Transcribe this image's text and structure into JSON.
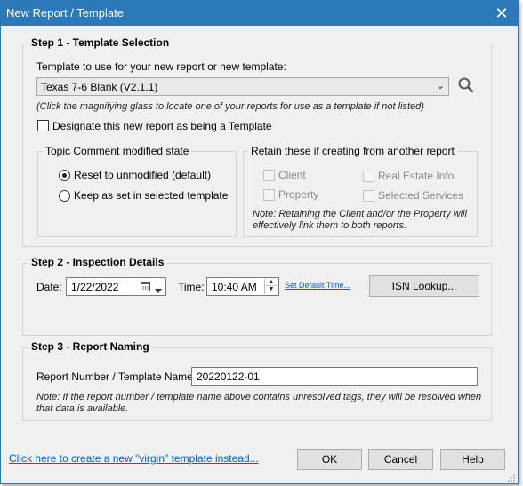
{
  "window": {
    "title": "New Report / Template",
    "close_glyph": "✕"
  },
  "step1": {
    "title": "Step 1 - Template Selection",
    "template_label": "Template to use for your new report or new template:",
    "template_value": "Texas 7-6 Blank (V2.1.1)",
    "magnify_note": "(Click the magnifying glass to locate one of your reports for use as a template if not listed)",
    "designate_label": "Designate this new report as being a Template",
    "designate_checked": false,
    "topic_group": {
      "title": "Topic Comment modified state",
      "options": [
        {
          "label": "Reset to unmodified (default)",
          "selected": true
        },
        {
          "label": "Keep as set in selected template",
          "selected": false
        }
      ]
    },
    "retain_group": {
      "title": "Retain these if creating from another report",
      "client": "Client",
      "property": "Property",
      "real_estate": "Real Estate Info",
      "selected_services": "Selected Services",
      "note_line1": "Note: Retaining the Client and/or the Property will",
      "note_line2": "effectively link them to both reports."
    }
  },
  "step2": {
    "title": "Step 2 - Inspection Details",
    "date_label": "Date:",
    "date_value": "1/22/2022",
    "time_label": "Time:",
    "time_value": "10:40 AM",
    "set_default_link": "Set Default Time...",
    "isn_button": "ISN Lookup..."
  },
  "step3": {
    "title": "Step 3 - Report Naming",
    "name_label": "Report Number / Template Name:",
    "name_value": "20220122-01",
    "note_line1": "Note: If the report number / template name above contains unresolved tags, they will be resolved when",
    "note_line2": "that data is available."
  },
  "footer": {
    "virgin_link": "Click here to create a new \"virgin\" template instead...",
    "ok": "OK",
    "cancel": "Cancel",
    "help": "Help"
  },
  "colors": {
    "titlebar": "#2b79b9",
    "link": "#0b5fbf",
    "dialog_bg": "#f0f0f0"
  }
}
